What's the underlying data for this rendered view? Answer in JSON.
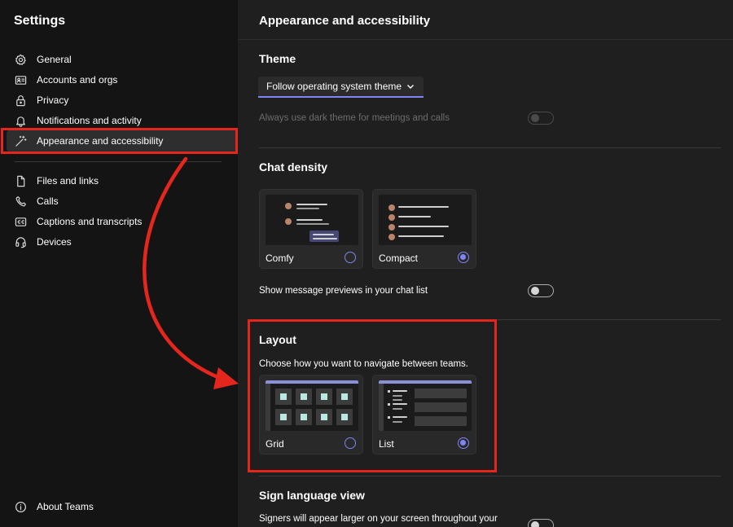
{
  "sidebar": {
    "title": "Settings",
    "items": [
      {
        "label": "General",
        "icon": "gear-icon"
      },
      {
        "label": "Accounts and orgs",
        "icon": "id-card-icon"
      },
      {
        "label": "Privacy",
        "icon": "lock-icon"
      },
      {
        "label": "Notifications and activity",
        "icon": "bell-icon"
      },
      {
        "label": "Appearance and accessibility",
        "icon": "magic-wand-icon",
        "active": true
      },
      {
        "label": "Files and links",
        "icon": "file-icon"
      },
      {
        "label": "Calls",
        "icon": "phone-icon"
      },
      {
        "label": "Captions and transcripts",
        "icon": "cc-icon"
      },
      {
        "label": "Devices",
        "icon": "headset-icon"
      }
    ],
    "about": {
      "label": "About Teams",
      "icon": "info-icon"
    }
  },
  "main": {
    "title": "Appearance and accessibility",
    "theme": {
      "title": "Theme",
      "selected": "Follow operating system theme",
      "dark_meetings_label": "Always use dark theme for meetings and calls",
      "dark_meetings_on": false,
      "dark_meetings_disabled": true
    },
    "chat_density": {
      "title": "Chat density",
      "options": [
        {
          "label": "Comfy",
          "selected": false
        },
        {
          "label": "Compact",
          "selected": true
        }
      ],
      "previews_label": "Show message previews in your chat list",
      "previews_on": false
    },
    "layout": {
      "title": "Layout",
      "description": "Choose how you want to navigate between teams.",
      "options": [
        {
          "label": "Grid",
          "selected": false
        },
        {
          "label": "List",
          "selected": true
        }
      ]
    },
    "sign_language": {
      "title": "Sign language view",
      "description": "Signers will appear larger on your screen throughout your"
    }
  },
  "colors": {
    "accent": "#7f85f5",
    "annotation_red": "#e5261c",
    "sidebar_bg": "#141414",
    "main_bg": "#1f1f1f"
  }
}
